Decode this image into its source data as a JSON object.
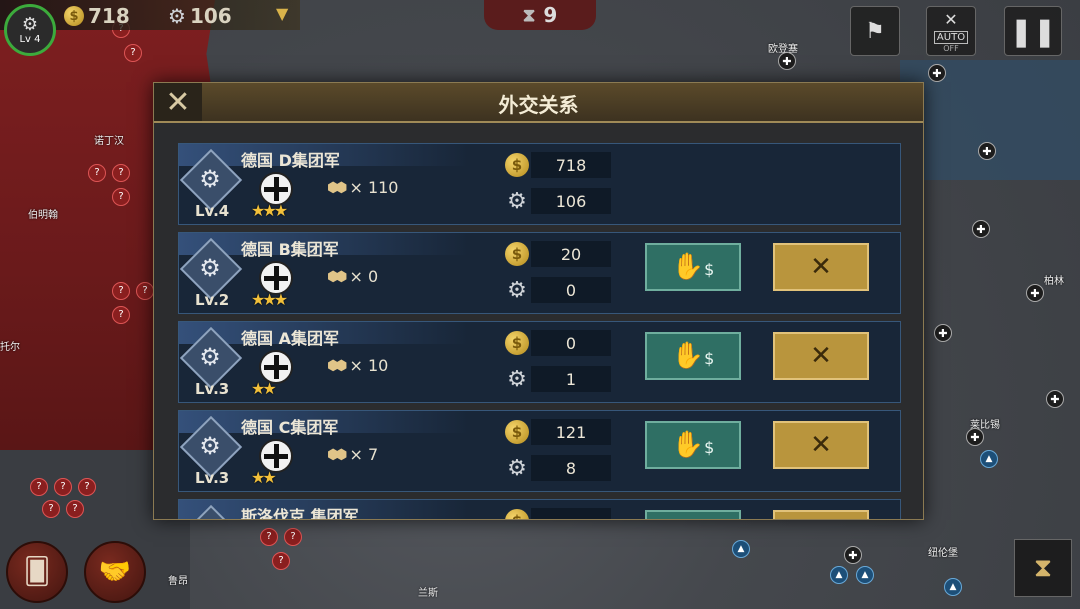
{
  "hud": {
    "level": "Lv 4",
    "gold": "718",
    "industry": "106",
    "turn": "9",
    "auto_label": "AUTO",
    "auto_state": "OFF"
  },
  "map": {
    "cities": [
      "欧登塞",
      "诺丁汉",
      "伯明翰",
      "托尔",
      "柏林",
      "莱比锡",
      "纽伦堡",
      "鲁昂",
      "兰斯"
    ]
  },
  "dialog": {
    "title": "外交关系",
    "rows": [
      {
        "name": "德国 D集团军",
        "level": "Lv.4",
        "stars": "★★★",
        "units": "× 110",
        "gold": "718",
        "industry": "106",
        "actions": false
      },
      {
        "name": "德国 B集团军",
        "level": "Lv.2",
        "stars": "★★★",
        "units": "× 0",
        "gold": "20",
        "industry": "0",
        "actions": true
      },
      {
        "name": "德国 A集团军",
        "level": "Lv.3",
        "stars": "★★",
        "units": "× 10",
        "gold": "0",
        "industry": "1",
        "actions": true
      },
      {
        "name": "德国 C集团军",
        "level": "Lv.3",
        "stars": "★★",
        "units": "× 7",
        "gold": "121",
        "industry": "8",
        "actions": true
      },
      {
        "name": "斯洛伐克 集团军",
        "level": "",
        "stars": "",
        "units": "",
        "gold": "",
        "industry": "",
        "actions": true
      }
    ]
  },
  "colors": {
    "accent_gold": "#b9953d",
    "aid_green": "#2f6f64",
    "row_bg": "#182638",
    "enemy_red": "#7e1f20"
  },
  "icons": {
    "close": "close-icon",
    "coin": "coin-icon",
    "gear": "gear-icon",
    "aid": "money-hand-icon",
    "war": "crossed-rifles-icon",
    "cards": "cards-icon",
    "diplomacy": "handshake-icon",
    "pause": "pause-icon",
    "flags": "flags-icon",
    "hourglass": "hourglass-icon"
  }
}
